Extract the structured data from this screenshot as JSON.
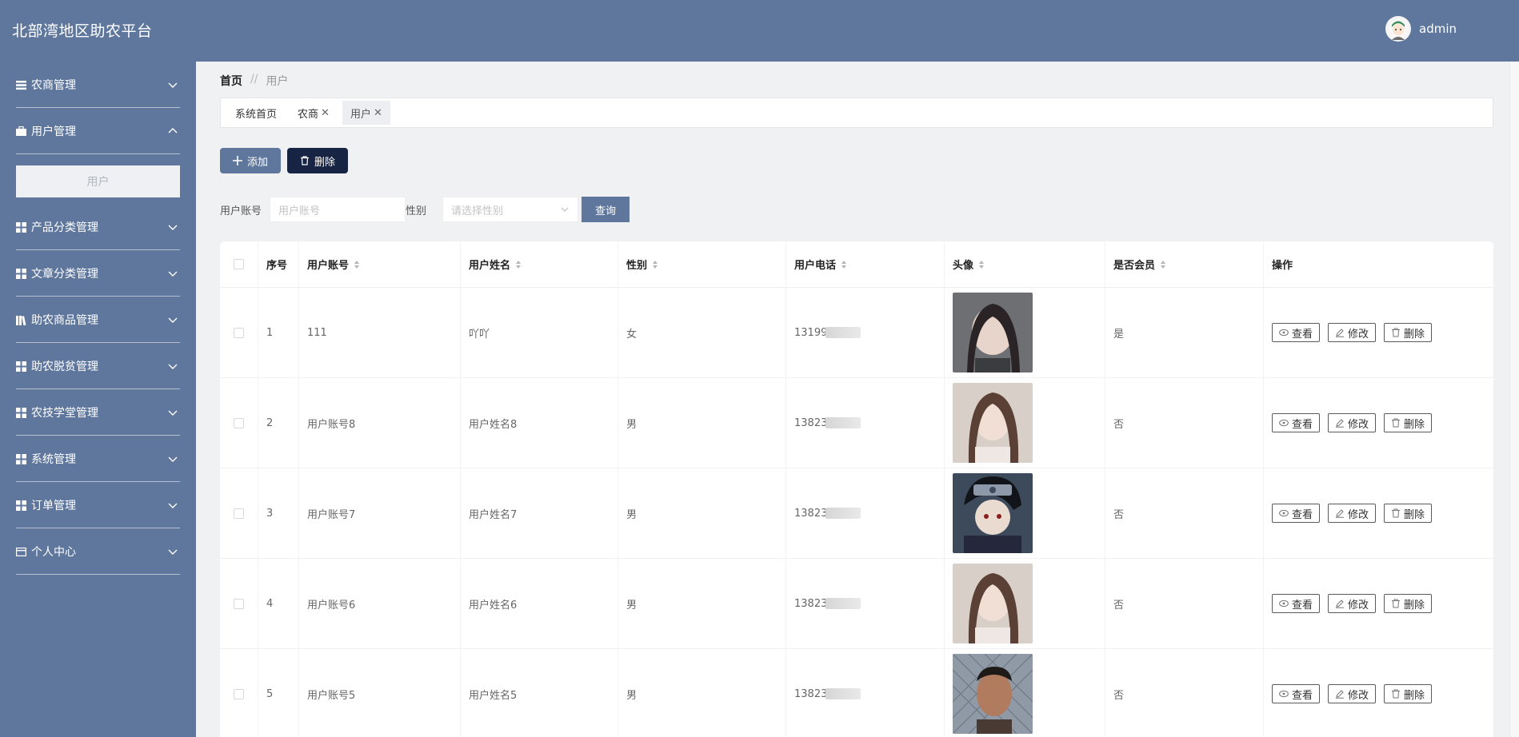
{
  "app": {
    "title": "北部湾地区助农平台",
    "user_name": "admin"
  },
  "sidebar": {
    "items": [
      {
        "label": "农商管理",
        "icon": "list-icon",
        "expanded": false
      },
      {
        "label": "用户管理",
        "icon": "briefcase-icon",
        "expanded": true,
        "sub": [
          "用户"
        ]
      },
      {
        "label": "产品分类管理",
        "icon": "grid-icon",
        "expanded": false
      },
      {
        "label": "文章分类管理",
        "icon": "grid-icon",
        "expanded": false
      },
      {
        "label": "助农商品管理",
        "icon": "books-icon",
        "expanded": false
      },
      {
        "label": "助农脱贫管理",
        "icon": "grid-icon",
        "expanded": false
      },
      {
        "label": "农技学堂管理",
        "icon": "grid-icon",
        "expanded": false
      },
      {
        "label": "系统管理",
        "icon": "grid-icon",
        "expanded": false
      },
      {
        "label": "订单管理",
        "icon": "grid-icon",
        "expanded": false
      },
      {
        "label": "个人中心",
        "icon": "card-icon",
        "expanded": false
      }
    ]
  },
  "breadcrumb": {
    "home": "首页",
    "sep": "//",
    "current": "用户"
  },
  "tags": [
    {
      "label": "系统首页",
      "closable": false,
      "active": false
    },
    {
      "label": "农商",
      "closable": true,
      "active": false
    },
    {
      "label": "用户",
      "closable": true,
      "active": true
    }
  ],
  "toolbar": {
    "add_label": "添加",
    "delete_label": "删除"
  },
  "search": {
    "account_label": "用户账号",
    "account_placeholder": "用户账号",
    "sex_label": "性别",
    "sex_placeholder": "请选择性别",
    "query_label": "查询"
  },
  "table": {
    "columns": [
      "序号",
      "用户账号",
      "用户姓名",
      "性别",
      "用户电话",
      "头像",
      "是否会员",
      "操作"
    ],
    "actions": {
      "view": "查看",
      "edit": "修改",
      "delete": "删除"
    },
    "rows": [
      {
        "idx": "1",
        "account": "111",
        "name": "吖吖",
        "sex": "女",
        "phone": "13199",
        "vip": "是"
      },
      {
        "idx": "2",
        "account": "用户账号8",
        "name": "用户姓名8",
        "sex": "男",
        "phone": "13823",
        "vip": "否"
      },
      {
        "idx": "3",
        "account": "用户账号7",
        "name": "用户姓名7",
        "sex": "男",
        "phone": "13823",
        "vip": "否"
      },
      {
        "idx": "4",
        "account": "用户账号6",
        "name": "用户姓名6",
        "sex": "男",
        "phone": "13823",
        "vip": "否"
      },
      {
        "idx": "5",
        "account": "用户账号5",
        "name": "用户姓名5",
        "sex": "男",
        "phone": "13823",
        "vip": "否"
      }
    ]
  },
  "colors": {
    "brand": "#5f779c",
    "dark_button": "#172443",
    "background": "#f0f1f3"
  }
}
